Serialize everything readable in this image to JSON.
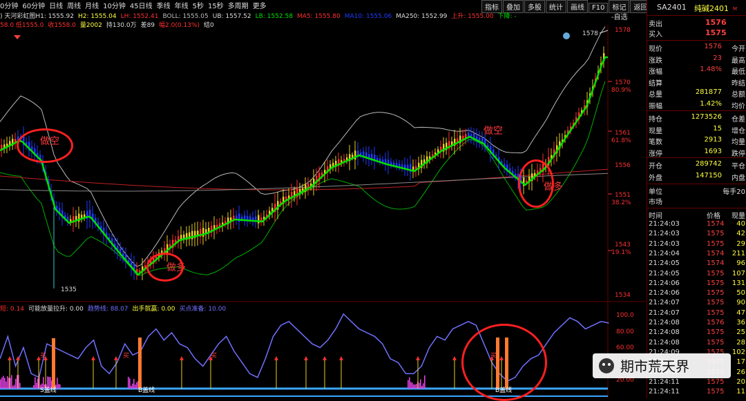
{
  "colors": {
    "up": "#ff3030",
    "down": "#1e3cff",
    "ma": "#00e000",
    "boll": "#bbbbbb",
    "ma250": "#c02020",
    "lb": "#00b000",
    "osc": "#7070ff",
    "axis": "#ff3030"
  },
  "tabs": [
    "0分钟",
    "60分钟",
    "日线",
    "周线",
    "月线",
    "10分钟",
    "45日线",
    "季线",
    "年线",
    "5秒",
    "15秒",
    "多周期",
    "更多"
  ],
  "tools": [
    "指标",
    "叠加",
    "多股",
    "统计",
    "画线",
    "F10",
    "标记",
    "返回"
  ],
  "legend1": [
    {
      "t": ") 天河彩虹图H1: 1555.92",
      "c": "#dddddd"
    },
    {
      "t": "H2: 1555.04",
      "c": "#ffff40"
    },
    {
      "t": "LH: 1552.41",
      "c": "#ff3030"
    },
    {
      "t": "BOLL: 1555.05",
      "c": "#bbbbbb"
    },
    {
      "t": "UB: 1557.52",
      "c": "#dddddd"
    },
    {
      "t": "LB: 1552.58",
      "c": "#00e000"
    },
    {
      "t": "MA5: 1555.80",
      "c": "#ff3030"
    },
    {
      "t": "MA10: 1555.06",
      "c": "#1e3cff"
    },
    {
      "t": "MA250: 1552.99",
      "c": "#dddddd"
    },
    {
      "t": "上升: 1555.00",
      "c": "#ff3030"
    },
    {
      "t": "下降: -",
      "c": "#00e000"
    }
  ],
  "legend2": [
    {
      "t": "58.0 低1555.0",
      "c": "#ff3030"
    },
    {
      "t": "收1558.0",
      "c": "#ff3030"
    },
    {
      "t": "量2002",
      "c": "#ffff40"
    },
    {
      "t": "持130.0万",
      "c": "#dddddd"
    },
    {
      "t": "差89",
      "c": "#dddddd"
    },
    {
      "t": "幅2.0(0.13%)",
      "c": "#ff3030"
    },
    {
      "t": "结0",
      "c": "#dddddd"
    }
  ],
  "legend3": [
    {
      "t": "短: 0.14",
      "c": "#ff3030"
    },
    {
      "t": "可能放量拉升: 0.00",
      "c": "#dddddd"
    },
    {
      "t": "趋势线: 88.07",
      "c": "#7070ff"
    },
    {
      "t": "出手就赢: 0.00",
      "c": "#ffff40"
    },
    {
      "t": "买点准备: 10.00",
      "c": "#7070ff"
    }
  ],
  "self_select": "-自选",
  "price_axis": [
    "1578",
    "1570",
    "80.9%",
    "1561",
    "61.8%",
    "1556",
    "1551",
    "38.2%",
    "1543",
    "19.1%",
    "1534"
  ],
  "osc_axis": [
    "100.0",
    "80.00",
    "60.00",
    "20.00"
  ],
  "marks": {
    "high": "1578",
    "low": "1535"
  },
  "annotations": [
    "做空",
    "做多",
    "做空",
    "做多"
  ],
  "osc_labels": [
    "买",
    "买",
    "买",
    "买",
    "S盖线",
    "B盖线",
    "B盖线"
  ],
  "chart_data": {
    "type": "candlestick",
    "price_range": [
      1534,
      1579
    ],
    "osc_range": [
      0,
      100
    ],
    "annotations": [
      "做空",
      "做多",
      "做空",
      "做多"
    ]
  },
  "panel": {
    "symbol": "SA2401",
    "name": "纯碱2401",
    "tag": "M",
    "ask": {
      "label": "卖出",
      "value": "1576"
    },
    "bid": {
      "label": "买入",
      "value": "1575"
    },
    "stats": [
      {
        "l": "现价",
        "v": "1576",
        "r": "今开"
      },
      {
        "l": "涨跌",
        "v": "23",
        "r": "最高"
      },
      {
        "l": "涨幅",
        "v": "1.48%",
        "r": "最低"
      },
      {
        "l": "结算",
        "v": "",
        "r": "昨结"
      },
      {
        "l": "总量",
        "v": "281877",
        "r": "总额"
      },
      {
        "l": "振幅",
        "v": "1.42%",
        "r": "均价"
      }
    ],
    "stats2": [
      {
        "l": "持仓",
        "v": "1273526",
        "r": "仓差"
      },
      {
        "l": "现量",
        "v": "15",
        "r": "增仓"
      },
      {
        "l": "笔数",
        "v": "2913",
        "r": "均量"
      },
      {
        "l": "涨停",
        "v": "1693",
        "r": "跌停"
      }
    ],
    "stats3": [
      {
        "l": "开仓",
        "v": "289742",
        "r": "平仓"
      },
      {
        "l": "外盘",
        "v": "147150",
        "r": "内盘"
      }
    ],
    "unit": {
      "l": "单位",
      "r": "每手20"
    },
    "market": {
      "l": "市场",
      "r": ""
    },
    "trade_header": {
      "t": "时间",
      "p": "价格",
      "q": "现量"
    },
    "trades": [
      {
        "t": "21:24:03",
        "p": "1574",
        "q": "40"
      },
      {
        "t": "21:24:03",
        "p": "1575",
        "q": "42"
      },
      {
        "t": "21:24:03",
        "p": "1575",
        "q": "29"
      },
      {
        "t": "21:24:04",
        "p": "1574",
        "q": "211"
      },
      {
        "t": "21:24:05",
        "p": "1574",
        "q": "96"
      },
      {
        "t": "21:24:05",
        "p": "1575",
        "q": "107"
      },
      {
        "t": "21:24:06",
        "p": "1575",
        "q": "131"
      },
      {
        "t": "21:24:06",
        "p": "1575",
        "q": "50"
      },
      {
        "t": "21:24:07",
        "p": "1575",
        "q": "90"
      },
      {
        "t": "21:24:07",
        "p": "1575",
        "q": "47"
      },
      {
        "t": "21:24:08",
        "p": "1576",
        "q": "36"
      },
      {
        "t": "21:24:08",
        "p": "1575",
        "q": "25"
      },
      {
        "t": "21:24:08",
        "p": "1575",
        "q": "28"
      },
      {
        "t": "21:24:09",
        "p": "1575",
        "q": "102"
      },
      {
        "t": "21:24:09",
        "p": "1575",
        "q": "17"
      },
      {
        "t": "21:24:10",
        "p": "1574",
        "q": "26"
      },
      {
        "t": "21:24:11",
        "p": "1575",
        "q": "20"
      },
      {
        "t": "21:24:11",
        "p": "1575",
        "q": "11"
      }
    ]
  },
  "watermark": "期市荒天界"
}
